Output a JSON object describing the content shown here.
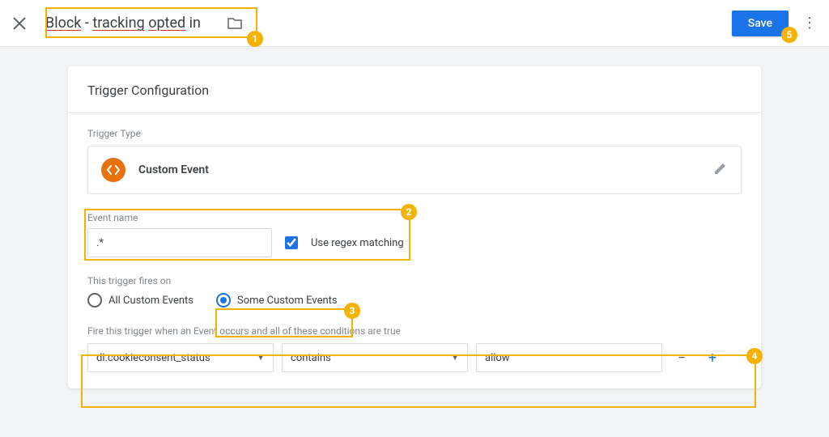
{
  "header": {
    "title": "Block - tracking opted in",
    "save_label": "Save"
  },
  "card": {
    "heading": "Trigger Configuration",
    "type_label": "Trigger Type",
    "type_name": "Custom Event",
    "event_name_label": "Event name",
    "event_name_value": ".*",
    "regex_label": "Use regex matching",
    "fires_on_label": "This trigger fires on",
    "radio": {
      "all": "All Custom Events",
      "some": "Some Custom Events",
      "selected": "some"
    },
    "condition_label": "Fire this trigger when an Event occurs and all of these conditions are true",
    "conditions": [
      {
        "variable": "dl.cookieconsent_status",
        "operator": "contains",
        "value": "allow"
      }
    ]
  },
  "annotations": {
    "badges": [
      "1",
      "2",
      "3",
      "4",
      "5"
    ]
  }
}
